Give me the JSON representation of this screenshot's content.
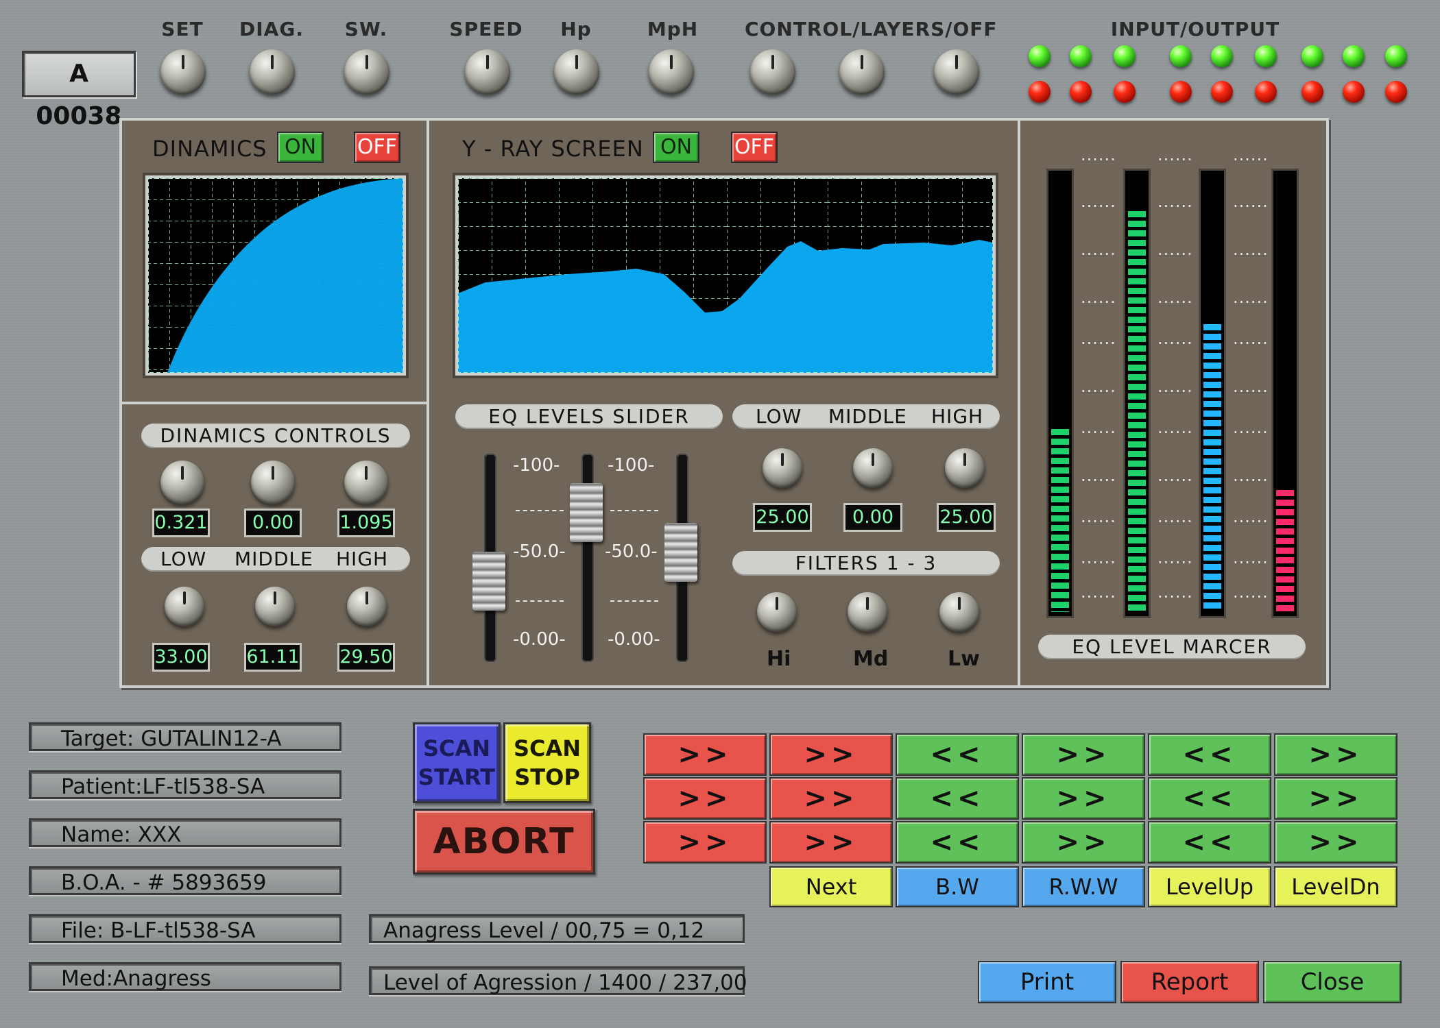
{
  "header": {
    "unit_id": "A 00038",
    "knob_labels": [
      "SET",
      "DIAG.",
      "SW.",
      "SPEED",
      "Hp",
      "MpH"
    ],
    "control_group_label": "CONTROL/LAYERS/OFF",
    "io_label": "INPUT/OUTPUT"
  },
  "dynamics": {
    "title": "DINAMICS",
    "on_label": "ON",
    "off_label": "OFF",
    "controls_title": "DINAMICS  CONTROLS",
    "controls_values": [
      "0.321",
      "0.00",
      "1.095"
    ],
    "band_labels": [
      "LOW",
      "MIDDLE",
      "HIGH"
    ],
    "band_values": [
      "33.00",
      "61.11",
      "29.50"
    ]
  },
  "yray": {
    "title": "Y - RAY SCREEN",
    "on_label": "ON",
    "off_label": "OFF",
    "eq_slider_title": "EQ  LEVELS  SLIDER",
    "scale": [
      "-100-",
      "-50.0-",
      "-0.00-"
    ],
    "slider_levels": [
      0.33,
      0.8,
      0.53
    ],
    "band_labels": [
      "LOW",
      "MIDDLE",
      "HIGH"
    ],
    "band_values": [
      "25.00",
      "0.00",
      "25.00"
    ],
    "filters_title": "FILTERS 1 - 3",
    "filter_labels": [
      "Hi",
      "Md",
      "Lw"
    ]
  },
  "meters": {
    "title": "EQ  LEVEL  MARCER",
    "levels": [
      0.42,
      0.92,
      0.66,
      0.28
    ],
    "colors": [
      "#1fd16a",
      "#1fd16a",
      "#25b8ff",
      "#ff2a6a"
    ],
    "marker_text": "......"
  },
  "info": {
    "target": "Target: GUTALIN12-A",
    "patient": "Patient:LF-tl538-SA",
    "name": "Name: XXX",
    "boa": "B.O.A. -  # 5893659",
    "file": "File: B-LF-tl538-SA",
    "med": "Med:Anagress",
    "anagress_level": "Anagress Level / 00,75 = 0,12",
    "agression_level": "Level of Agression / 1400 / 237,00"
  },
  "scan": {
    "start_line1": "SCAN",
    "start_line2": "START",
    "stop_line1": "SCAN",
    "stop_line2": "STOP",
    "abort": "ABORT"
  },
  "arrows": {
    "rows": [
      [
        ">>",
        ">>",
        "<<",
        ">>",
        "<<",
        ">>"
      ],
      [
        ">>",
        ">>",
        "<<",
        ">>",
        "<<",
        ">>"
      ],
      [
        ">>",
        ">>",
        "<<",
        ">>",
        "<<",
        ">>"
      ]
    ]
  },
  "nav": {
    "next": "Next",
    "bw": "B.W",
    "rww": "R.W.W",
    "levelup": "LevelUp",
    "leveldn": "LevelDn"
  },
  "footer": {
    "print": "Print",
    "report": "Report",
    "close": "Close"
  }
}
